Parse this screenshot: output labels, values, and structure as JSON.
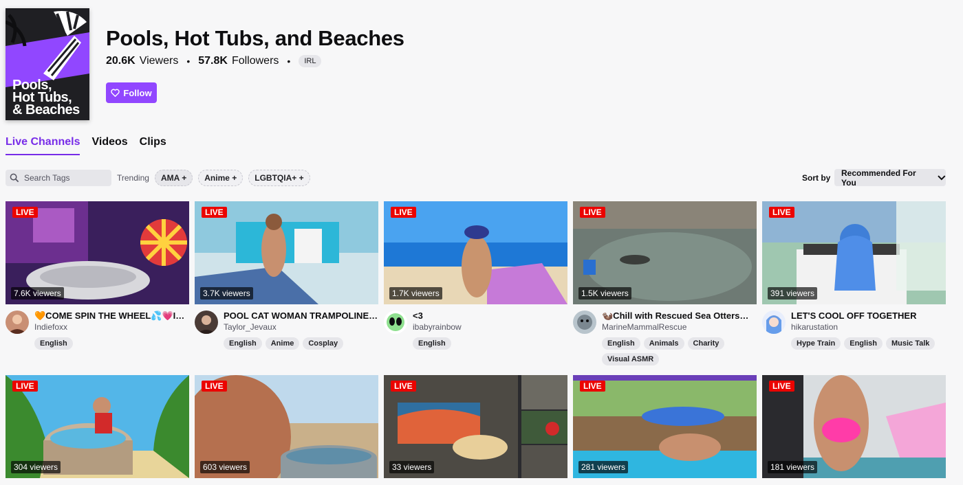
{
  "category": {
    "title": "Pools, Hot Tubs, and Beaches",
    "art_text_lines": [
      "Pools,",
      "Hot Tubs,",
      "& Beaches"
    ],
    "viewers_count": "20.6K",
    "viewers_label": "Viewers",
    "followers_count": "57.8K",
    "followers_label": "Followers",
    "tag": "IRL",
    "follow_label": "Follow"
  },
  "tabs": [
    "Live Channels",
    "Videos",
    "Clips"
  ],
  "filters": {
    "search_placeholder": "Search Tags",
    "trending_label": "Trending",
    "trending_tags": [
      "AMA +",
      "Anime +",
      "LGBTQIA+ +"
    ],
    "sort_label": "Sort by",
    "sort_value": "Recommended For You"
  },
  "live_badge": "LIVE",
  "streams": [
    {
      "viewers": "7.6K viewers",
      "title": "🧡COME SPIN THE WHEEL💦💗IG:indiefoxx",
      "channel": "Indiefoxx",
      "tags": [
        "English"
      ]
    },
    {
      "viewers": "3.7K viewers",
      "title": "POOL CAT WOMAN TRAMPOLINE WORKOUT",
      "channel": "Taylor_Jevaux",
      "tags": [
        "English",
        "Anime",
        "Cosplay"
      ]
    },
    {
      "viewers": "1.7K viewers",
      "title": "<3",
      "channel": "ibabyrainbow",
      "tags": [
        "English"
      ]
    },
    {
      "viewers": "1.5K viewers",
      "title": "🦦Chill with Rescued Sea Otters🦦 T...",
      "channel": "MarineMammalRescue",
      "tags": [
        "English",
        "Animals",
        "Charity",
        "Visual ASMR"
      ]
    },
    {
      "viewers": "391 viewers",
      "title": "LET'S COOL OFF TOGETHER",
      "channel": "hikarustation",
      "tags": [
        "Hype Train",
        "English",
        "Music Talk"
      ]
    },
    {
      "viewers": "304 viewers"
    },
    {
      "viewers": "603 viewers"
    },
    {
      "viewers": "33 viewers"
    },
    {
      "viewers": "281 viewers"
    },
    {
      "viewers": "181 viewers"
    }
  ],
  "colors": {
    "brand": "#9147ff",
    "live": "#eb0400",
    "active_tab": "#772ce8"
  },
  "icons": {
    "follow": "heart-icon",
    "search": "search-icon",
    "sort": "chevron-down-icon"
  }
}
